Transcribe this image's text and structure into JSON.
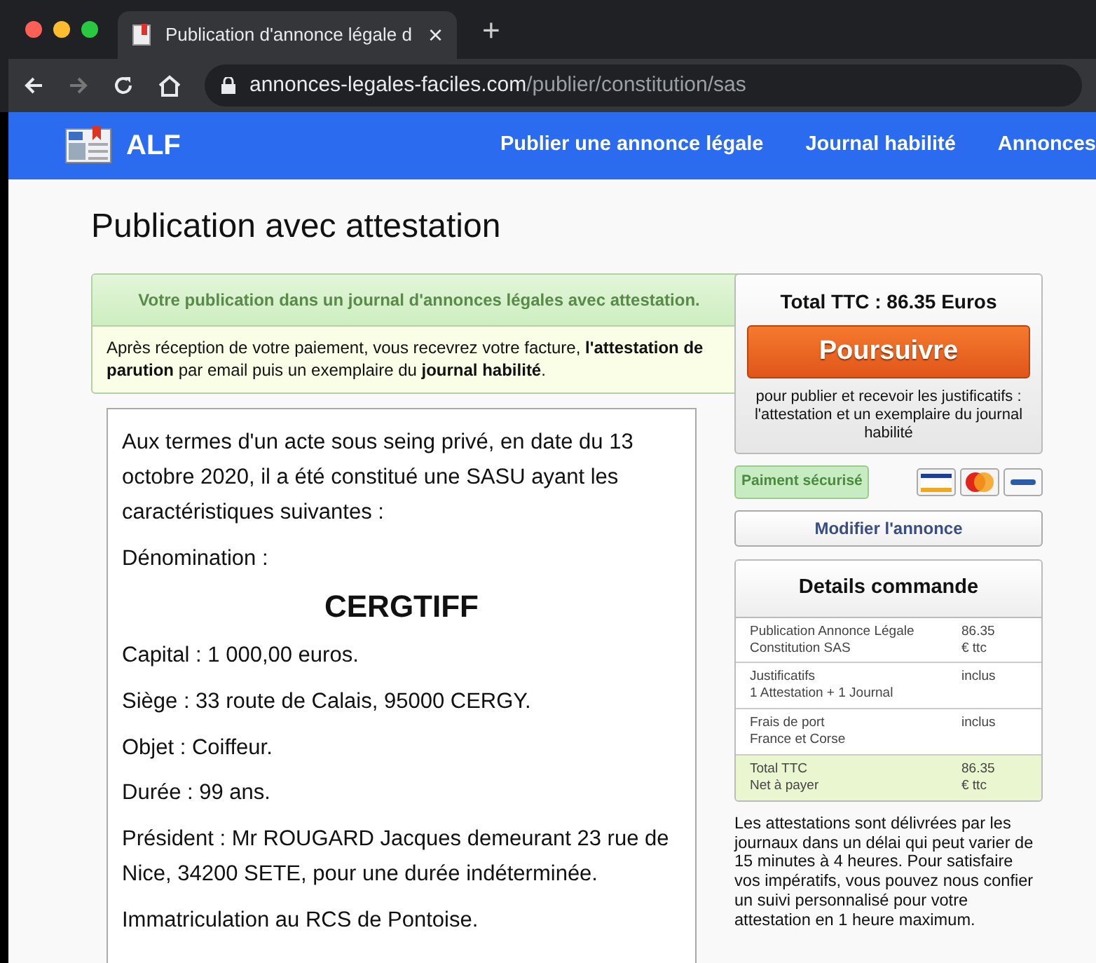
{
  "browser": {
    "tab_title": "Publication d'annonce légale d",
    "tab_close": "×",
    "new_tab": "+",
    "url_host": "annonces-legales-faciles.com",
    "url_path": "/publier/constitution/sas"
  },
  "navbar": {
    "brand": "ALF",
    "links": [
      "Publier une annonce légale",
      "Journal habilité",
      "Annonces"
    ]
  },
  "page_title": "Publication avec attestation",
  "notice": {
    "heading": "Votre publication dans un journal d'annonces légales avec attestation.",
    "body": "Après réception de votre paiement, vous recevrez votre facture, **l'attestation de parution** par email puis un exemplaire du **journal habilité**."
  },
  "announcement": [
    {
      "kind": "text",
      "text": "Aux termes d'un acte sous seing privé, en date du 13 octobre 2020, il a été constitué une SASU ayant les caractéristiques suivantes :"
    },
    {
      "kind": "text",
      "text": "Dénomination :"
    },
    {
      "kind": "name",
      "text": "CERGTIFF"
    },
    {
      "kind": "text",
      "text": "Capital : 1 000,00 euros."
    },
    {
      "kind": "text",
      "text": "Siège : 33 route de Calais, 95000 CERGY."
    },
    {
      "kind": "text",
      "text": "Objet : Coiffeur."
    },
    {
      "kind": "text",
      "text": "Durée : 99 ans."
    },
    {
      "kind": "text",
      "text": "Président : Mr ROUGARD Jacques demeurant 23 rue de Nice, 34200 SETE, pour une durée indéterminée."
    },
    {
      "kind": "text",
      "text": "Immatriculation au RCS de Pontoise."
    }
  ],
  "checkout": {
    "total": "Total TTC : 86.35 Euros",
    "button": "Poursuivre",
    "note": "pour publier et recevoir les justificatifs : l'attestation et un exemplaire du journal habilité",
    "secure_badge": "Paiment sécurisé",
    "edit_button": "Modifier l'annonce"
  },
  "details": {
    "title": "Details commande",
    "rows": [
      {
        "label": "Publication Annonce Légale",
        "sublabel": "Constitution SAS",
        "value": "86.35",
        "subvalue": "€ ttc",
        "highlighted": false
      },
      {
        "label": "Justificatifs",
        "sublabel": "1 Attestation + 1 Journal",
        "value": "inclus",
        "highlighted": false
      },
      {
        "label": "Frais de port",
        "sublabel": "France et Corse",
        "value": "inclus",
        "highlighted": false
      },
      {
        "label": "Total TTC",
        "sublabel": "Net à payer",
        "value": "86.35",
        "subvalue": "€ ttc",
        "highlighted": true
      }
    ]
  },
  "footnote": "Les attestations sont délivrées par les journaux dans un délai qui peut varier de 15 minutes à 4 heures. Pour satisfaire vos impératifs, vous pouvez nous confier un suivi personnalisé pour votre attestation en 1 heure maximum."
}
